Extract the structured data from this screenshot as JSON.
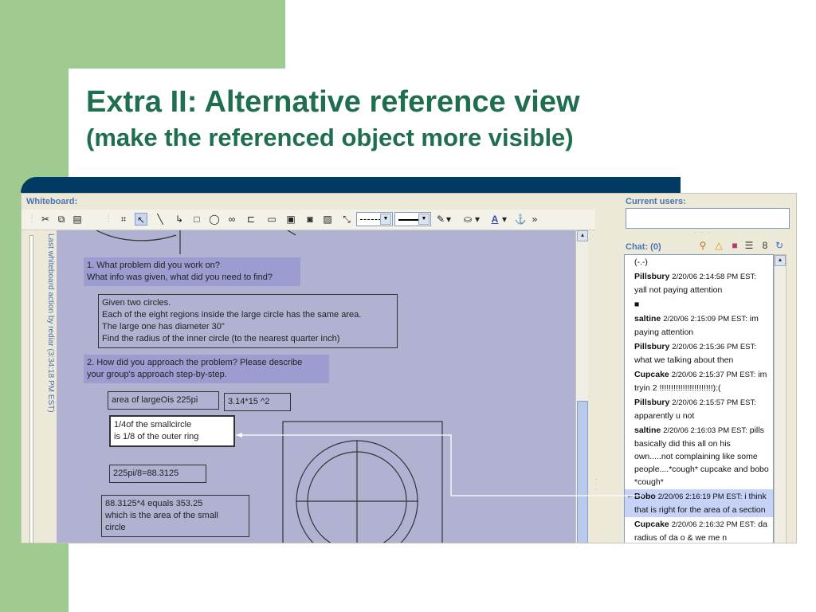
{
  "slide": {
    "title": "Extra II: Alternative reference view",
    "subtitle": "(make the referenced object more visible)"
  },
  "whiteboard": {
    "title": "Whiteboard:",
    "side_label": "Last whiteboard action by rediar (3:34:18 PM EST)",
    "boxes": [
      {
        "id": "q1",
        "style": "q",
        "lines": [
          "1. What problem did you work on?",
          "What info was given, what did you need to find?"
        ]
      },
      {
        "id": "given",
        "style": "out",
        "lines": [
          "Given two circles.",
          "Each of the eight regions inside the large circle has the same area.",
          "The large one has diameter 30\"",
          "Find the radius of the inner circle (to the nearest quarter inch)"
        ]
      },
      {
        "id": "q2",
        "style": "q",
        "lines": [
          "2. How did you approach the problem? Please describe",
          "your group's approach step-by-step."
        ]
      },
      {
        "id": "area",
        "style": "out",
        "lines": [
          "area of largeOis 225pi"
        ]
      },
      {
        "id": "calc",
        "style": "out",
        "lines": [
          "3.14*15 ^2"
        ]
      },
      {
        "id": "ref",
        "style": "hl",
        "lines": [
          "1/4of the smallcircle",
          "is 1/8 of the outer ring"
        ]
      },
      {
        "id": "div",
        "style": "out",
        "lines": [
          "225pi/8=88.3125"
        ]
      },
      {
        "id": "mult",
        "style": "out",
        "lines": [
          "88.3125*4 equals 353.25",
          "which is the area of the small",
          "circle"
        ]
      }
    ]
  },
  "right": {
    "users_title": "Current users:",
    "chat_title": "Chat: (0)",
    "messages": [
      {
        "name": "",
        "time": "",
        "text": "(-.-)"
      },
      {
        "name": "Pillsbury",
        "time": "2/20/06 2:14:58 PM EST:",
        "text": "yall not paying attention"
      },
      {
        "name": "",
        "time": "",
        "text": "■"
      },
      {
        "name": "saltine",
        "time": "2/20/06 2:15:09 PM EST:",
        "text": "im paying attention"
      },
      {
        "name": "Pillsbury",
        "time": "2/20/06 2:15:36 PM EST:",
        "text": "what we talking about then"
      },
      {
        "name": "Cupcake",
        "time": "2/20/06 2:15:37 PM EST:",
        "text": "im tryin 2 !!!!!!!!!!!!!!!!!!!!!!!):("
      },
      {
        "name": "Pillsbury",
        "time": "2/20/06 2:15:57 PM EST:",
        "text": "apparently u not"
      },
      {
        "name": "saltine",
        "time": "2/20/06 2:16:03 PM EST:",
        "text": "pills basically did this all on his own.....not complaining like some people....*cough* cupcake and bobo *cough*"
      },
      {
        "name": "Bobo",
        "time": "2/20/06 2:16:19 PM EST:",
        "text": "i think that is right for the area of a section",
        "highlight": true
      },
      {
        "name": "Cupcake",
        "time": "2/20/06 2:16:32 PM EST:",
        "text": "da radius of da o & we me n"
      }
    ]
  },
  "colors": {
    "accent_green": "#9fcb91",
    "title_green": "#1f6e4e",
    "band_navy": "#013b63",
    "canvas_lavender": "#b1b1d2",
    "question_box": "#9c9cd0",
    "highlight_message": "#c6d3f6"
  },
  "icons": {
    "toolbar": [
      "cut-icon",
      "copy-icon",
      "paste-icon",
      "lasso-icon",
      "pointer-icon",
      "line-icon",
      "connector-icon",
      "rectangle-icon",
      "ellipse-icon",
      "equation-icon",
      "callout-icon",
      "text-icon",
      "image-icon",
      "camera-icon",
      "picture-icon",
      "link-icon",
      "dash-style-icon",
      "line-width-icon",
      "pen-color-icon",
      "fill-color-icon",
      "font-color-icon",
      "anchor-icon",
      "more-icon"
    ],
    "chat": [
      "search-icon",
      "alert-icon",
      "palette-icon",
      "list-icon",
      "settings-icon",
      "refresh-icon"
    ]
  }
}
